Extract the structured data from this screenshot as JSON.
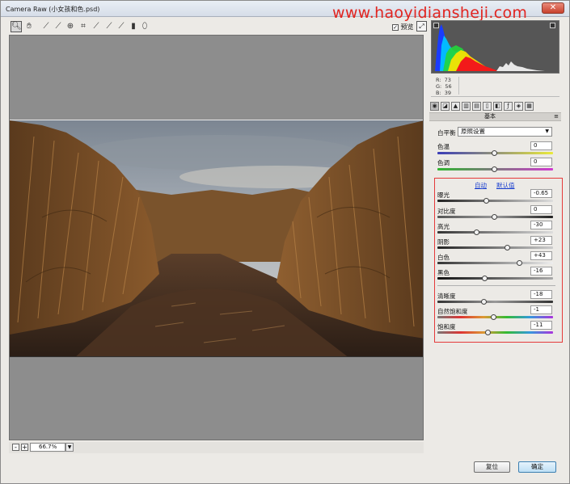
{
  "window": {
    "title": "Camera Raw (小女孩和色.psd)",
    "close_symbol": "✕"
  },
  "watermark": "www.haoyidiansheji.com",
  "toolbar": {
    "tools": [
      "zoom-icon",
      "hand-icon",
      "white-balance-icon",
      "color-sampler-icon",
      "target-adjust-icon",
      "crop-icon",
      "straighten-icon",
      "spot-removal-icon",
      "red-eye-icon",
      "adjustment-brush-icon",
      "graduated-filter-icon"
    ],
    "preview_label": "预览",
    "preview_checked": true
  },
  "zoom": {
    "value": "66.7%",
    "minus": "-",
    "plus": "+"
  },
  "rgb": {
    "r_label": "R:",
    "r_value": "73",
    "g_label": "G:",
    "g_value": "56",
    "b_label": "B:",
    "b_value": "39"
  },
  "panel": {
    "section_title": "基本",
    "white_balance_label": "白平衡",
    "white_balance_value": "原照设置",
    "temperature": {
      "label": "色温",
      "value": "0"
    },
    "tint": {
      "label": "色调",
      "value": "0"
    },
    "auto_link": "自动",
    "default_link": "默认值",
    "exposure": {
      "label": "曝光",
      "value": "-0.65"
    },
    "contrast": {
      "label": "对比度",
      "value": "0"
    },
    "highlights": {
      "label": "高光",
      "value": "-30"
    },
    "shadows": {
      "label": "阴影",
      "value": "+23"
    },
    "whites": {
      "label": "白色",
      "value": "+43"
    },
    "blacks": {
      "label": "黑色",
      "value": "-16"
    },
    "clarity": {
      "label": "清晰度",
      "value": "-18"
    },
    "vibrance": {
      "label": "自然饱和度",
      "value": "-1"
    },
    "saturation": {
      "label": "饱和度",
      "value": "-11"
    }
  },
  "buttons": {
    "reset": "复位",
    "ok": "确定"
  },
  "colors": {
    "accent_red": "#e53a3a",
    "link_blue": "#1a3fcf"
  }
}
